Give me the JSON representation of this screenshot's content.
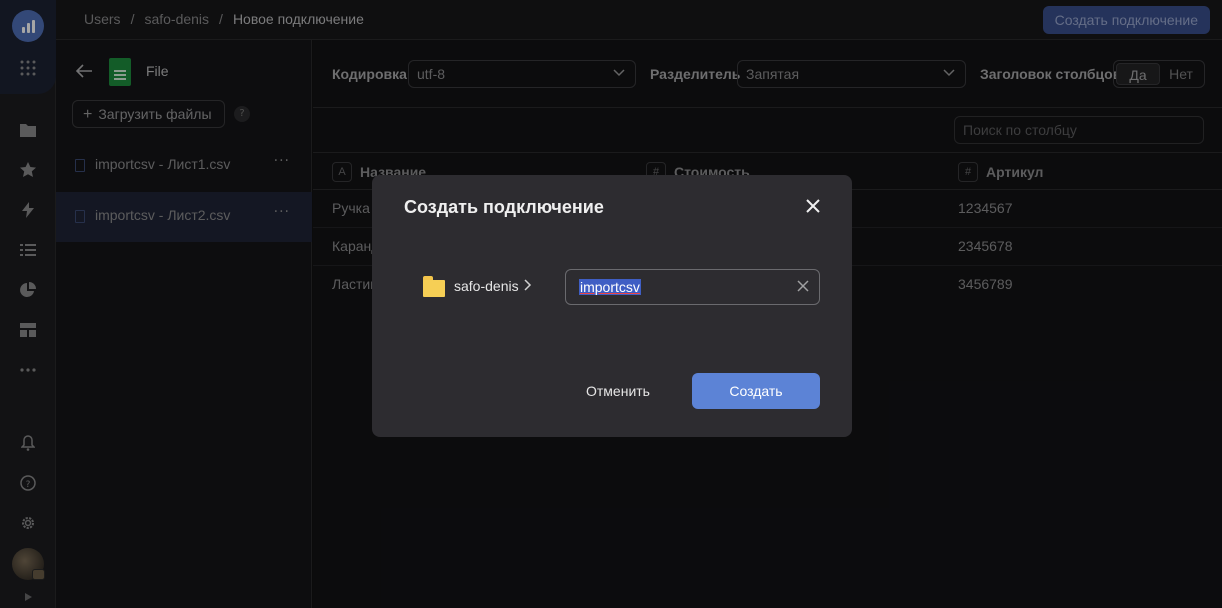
{
  "breadcrumbs": [
    "Users",
    "safo-denis",
    "Новое подключение"
  ],
  "breadcrumb_separator": "/",
  "header": {
    "create_button_label": "Создать подключение"
  },
  "rail": {
    "icons": [
      "logo-icon",
      "apps-grid-icon",
      "folder-icon",
      "star-icon",
      "lightning-icon",
      "dataset-icon",
      "pie-chart-icon",
      "dashboard-icon",
      "more-icon",
      "bell-icon",
      "help-icon",
      "settings-icon",
      "avatar",
      "expand-icon"
    ]
  },
  "file_panel": {
    "title": "File",
    "upload_label": "Загрузить файлы",
    "help_label": "?",
    "files": [
      {
        "name": "importcsv - Лист1.csv",
        "selected": false
      },
      {
        "name": "importcsv - Лист2.csv",
        "selected": true
      }
    ],
    "more_label": "···"
  },
  "toolbar": {
    "encoding_label": "Кодировка",
    "encoding_value": "utf-8",
    "delimiter_label": "Разделитель",
    "delimiter_value": "Запятая",
    "header_label": "Заголовок столбцов",
    "header_yes": "Да",
    "header_no": "Нет",
    "search_placeholder": "Поиск по столбцу"
  },
  "table": {
    "columns": [
      {
        "type_icon": "A",
        "name": "Название"
      },
      {
        "type_icon": "#",
        "name": "Стоимость"
      },
      {
        "type_icon": "#",
        "name": "Артикул"
      }
    ],
    "rows": [
      [
        "Ручка",
        "",
        "1234567"
      ],
      [
        "Каранд",
        "",
        "2345678"
      ],
      [
        "Ластик",
        "",
        "3456789"
      ]
    ]
  },
  "modal": {
    "title": "Создать подключение",
    "close_label": "✕",
    "folder_name": "safo-denis",
    "name_value": "importcsv",
    "cancel_label": "Отменить",
    "create_label": "Создать"
  },
  "colors": {
    "accent": "#5c83d6",
    "folder": "#f6cf55",
    "modal_bg": "#2d2c30",
    "selection": "#3f5ec4"
  }
}
